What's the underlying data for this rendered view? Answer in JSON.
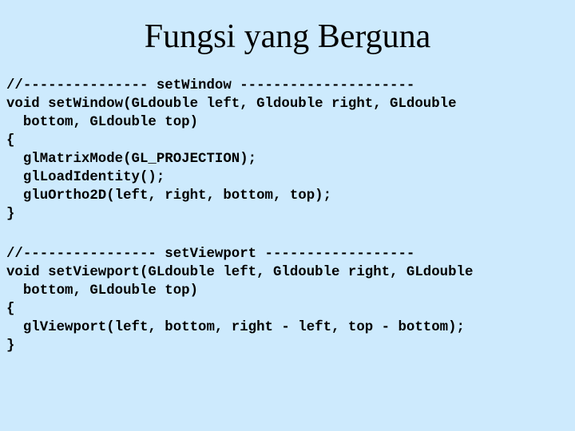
{
  "slide": {
    "title": "Fungsi yang Berguna",
    "background_color": "#cdeafd",
    "code_blocks": [
      {
        "lines": [
          "//--------------- setWindow ---------------------",
          "void setWindow(GLdouble left, Gldouble right, GLdouble",
          "  bottom, GLdouble top)",
          "{",
          "  glMatrixMode(GL_PROJECTION);",
          "  glLoadIdentity();",
          "  gluOrtho2D(left, right, bottom, top);",
          "}"
        ]
      },
      {
        "lines": [
          "//---------------- setViewport ------------------",
          "void setViewport(GLdouble left, Gldouble right, GLdouble",
          "  bottom, GLdouble top)",
          "{",
          "  glViewport(left, bottom, right - left, top - bottom);",
          "}"
        ]
      }
    ]
  }
}
